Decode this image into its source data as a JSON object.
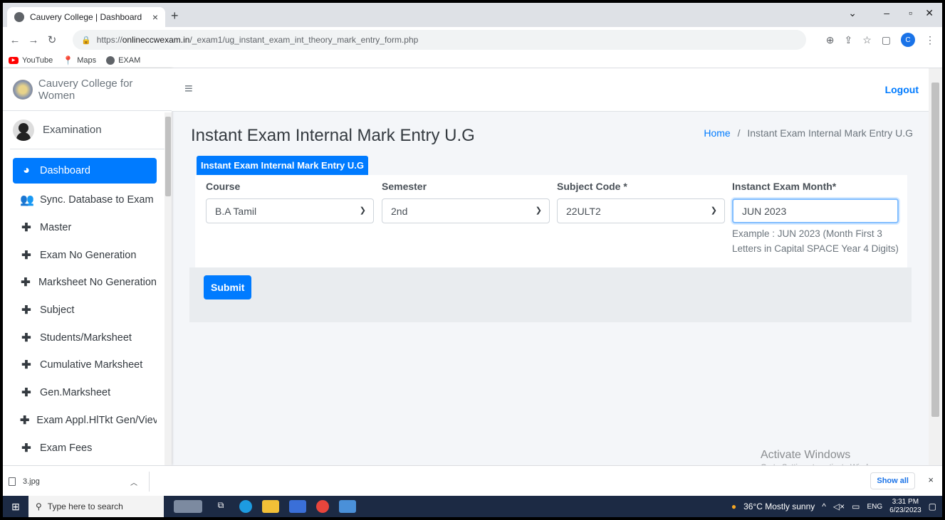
{
  "browser": {
    "tab_title": "Cauvery College | Dashboard",
    "tab_close": "×",
    "new_tab": "+",
    "url_prefix": "https://",
    "url_host": "onlineccwexam.in",
    "url_path": "/_exam1/ug_instant_exam_int_theory_mark_entry_form.php",
    "profile_initial": "C",
    "bookmarks": [
      {
        "label": "YouTube",
        "icon": "youtube-icon"
      },
      {
        "label": "Maps",
        "icon": "maps-pin-icon"
      },
      {
        "label": "EXAM",
        "icon": "globe-icon"
      }
    ]
  },
  "sidebar": {
    "brand": "Cauvery College for Women",
    "user": "Examination",
    "items": [
      {
        "label": "Dashboard",
        "icon": "tachometer-icon",
        "active": true
      },
      {
        "label": "Sync. Database to Exam P",
        "icon": "user-plus-icon"
      },
      {
        "label": "Master",
        "icon": "plus-icon"
      },
      {
        "label": "Exam No Generation",
        "icon": "plus-icon"
      },
      {
        "label": "Marksheet No Generation",
        "icon": "plus-icon"
      },
      {
        "label": "Subject",
        "icon": "plus-icon"
      },
      {
        "label": "Students/Marksheet",
        "icon": "plus-icon"
      },
      {
        "label": "Cumulative Marksheet",
        "icon": "plus-icon"
      },
      {
        "label": "Gen.Marksheet",
        "icon": "plus-icon"
      },
      {
        "label": "Exam Appl.HlTkt Gen/Viev",
        "icon": "plus-icon"
      },
      {
        "label": "Exam Fees",
        "icon": "plus-icon"
      }
    ]
  },
  "topnav": {
    "logout": "Logout"
  },
  "main": {
    "title": "Instant Exam Internal Mark Entry U.G",
    "breadcrumb_home": "Home",
    "breadcrumb_sep": "/",
    "breadcrumb_current": "Instant Exam Internal Mark Entry U.G",
    "card_tab": "Instant Exam Internal Mark Entry U.G",
    "form": {
      "course_label": "Course",
      "course_value": "B.A Tamil",
      "semester_label": "Semester",
      "semester_value": "2nd",
      "subject_label": "Subject Code *",
      "subject_value": "22ULT2",
      "month_label": "Instanct Exam Month*",
      "month_value": "JUN 2023",
      "month_hint": "Example : JUN 2023 (Month First 3 Letters in Capital SPACE Year 4 Digits)"
    },
    "submit": "Submit"
  },
  "watermark": {
    "line1": "Activate Windows",
    "line2": "Go to Settings to activate Windows."
  },
  "downloads": {
    "file": "3.jpg",
    "show_all": "Show all",
    "close": "×"
  },
  "taskbar": {
    "search_placeholder": "Type here to search",
    "weather": "36°C  Mostly sunny",
    "lang": "ENG",
    "time": "3:31 PM",
    "date": "6/23/2023"
  },
  "colors": {
    "accent": "#007bff",
    "taskbar": "#1c2a44"
  }
}
